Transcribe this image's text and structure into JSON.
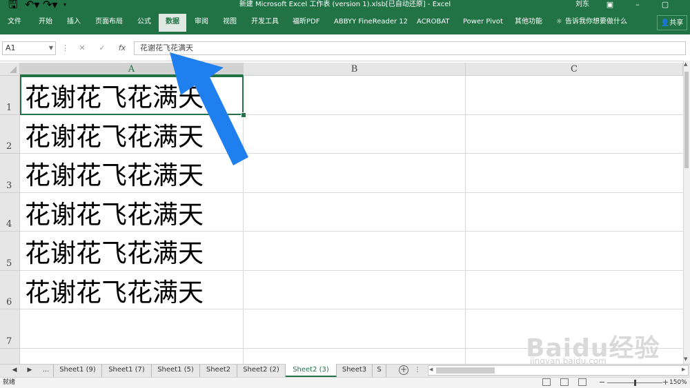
{
  "window": {
    "title": "新建 Microsoft Excel 工作表 (version 1).xlsb[已自动还原] - Excel",
    "user": "刘东",
    "quick_access": [
      "save-icon",
      "undo-icon",
      "redo-icon",
      "customize-icon"
    ]
  },
  "ribbon": {
    "tabs": [
      "文件",
      "开始",
      "插入",
      "页面布局",
      "公式",
      "数据",
      "审阅",
      "视图",
      "开发工具",
      "福昕PDF",
      "ABBYY FineReader 12",
      "ACROBAT",
      "Power Pivot",
      "其他功能"
    ],
    "active_tab": "数据",
    "tell_me": "告诉我你想要做什么",
    "share": "共享"
  },
  "formula_bar": {
    "name_box": "A1",
    "fx": "fx",
    "content": "花谢花飞花满天"
  },
  "grid": {
    "columns": [
      "A",
      "B",
      "C"
    ],
    "rows": [
      "1",
      "2",
      "3",
      "4",
      "5",
      "6",
      "7"
    ],
    "cells": [
      "花谢花飞花满天",
      "花谢花飞花满天",
      "花谢花飞花满天",
      "花谢花飞花满天",
      "花谢花飞花满天",
      "花谢花飞花满天"
    ],
    "selected_cell": "A1"
  },
  "sheet_tabs": {
    "more": "...",
    "items": [
      "Sheet1 (9)",
      "Sheet1 (7)",
      "Sheet1 (5)",
      "Sheet2",
      "Sheet2 (2)",
      "Sheet2 (3)",
      "Sheet3"
    ],
    "active": "Sheet2 (3)"
  },
  "status_bar": {
    "status": "就绪",
    "zoom": "150%"
  },
  "watermark": {
    "logo": "Baidu经验",
    "url": "jingyan.baidu.com"
  },
  "annotation": {
    "arrow_color": "#1f7fef"
  }
}
